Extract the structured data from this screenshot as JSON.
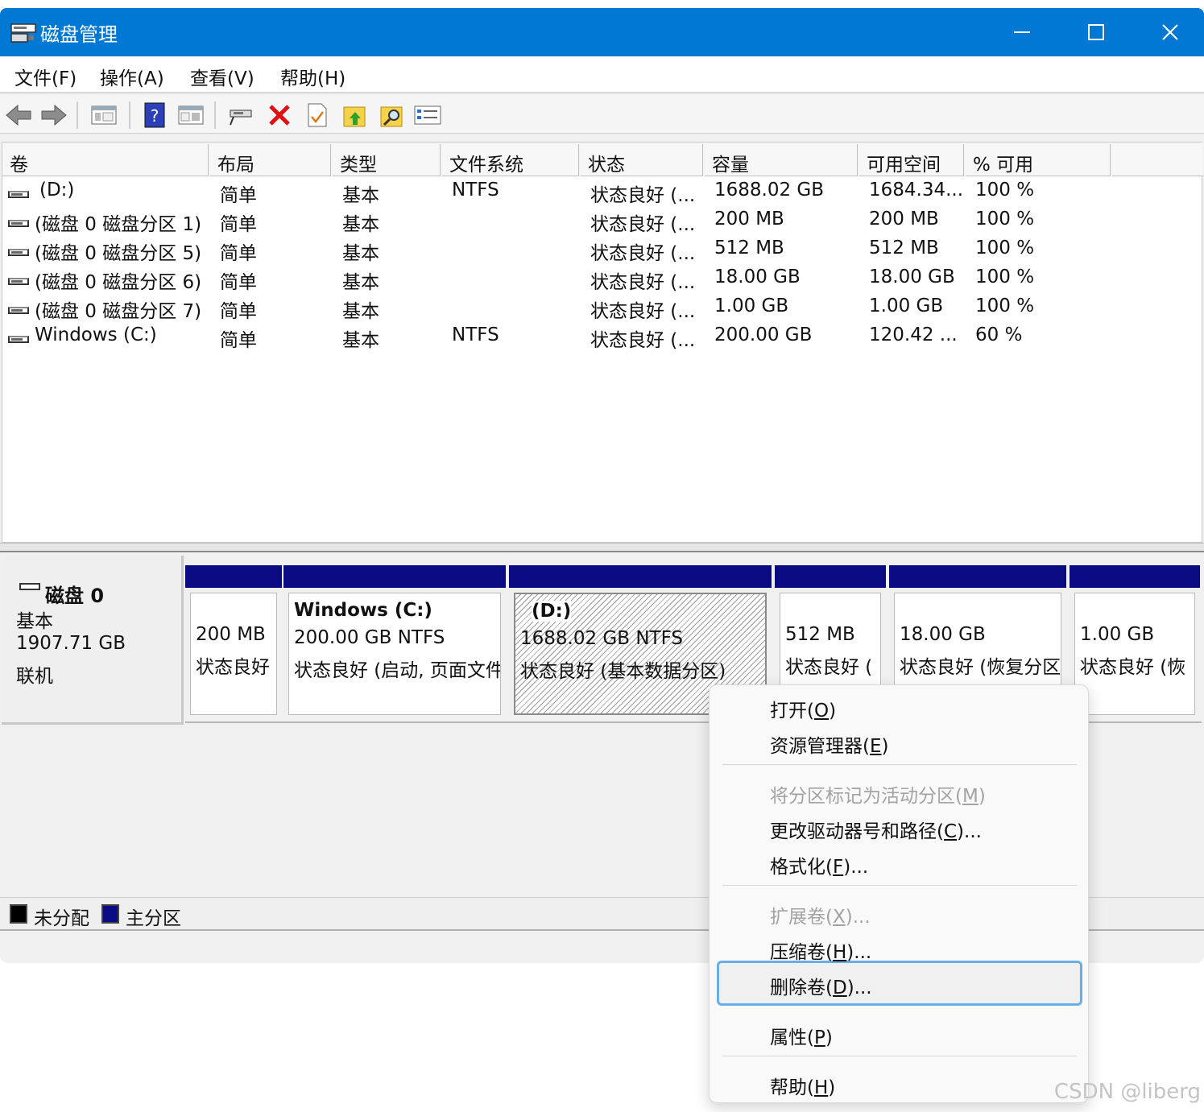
{
  "window": {
    "title": "磁盘管理"
  },
  "menu": [
    "文件(F)",
    "操作(A)",
    "查看(V)",
    "帮助(H)"
  ],
  "toolbar": {
    "icons": [
      "back-arrow-icon",
      "forward-arrow-icon",
      "console-tree-icon",
      "help-icon",
      "action-pane-icon",
      "connect-drive-icon",
      "delete-icon",
      "properties-icon",
      "up-folder-icon",
      "search-folder-icon",
      "details-list-icon"
    ]
  },
  "volume_table": {
    "headers": [
      "卷",
      "布局",
      "类型",
      "文件系统",
      "状态",
      "容量",
      "可用空间",
      "% 可用"
    ],
    "rows": [
      [
        "(D:)",
        "简单",
        "基本",
        "NTFS",
        "状态良好 (...",
        "1688.02 GB",
        "1684.34...",
        "100 %"
      ],
      [
        "(磁盘 0 磁盘分区 1)",
        "简单",
        "基本",
        "",
        "状态良好 (...",
        "200 MB",
        "200 MB",
        "100 %"
      ],
      [
        "(磁盘 0 磁盘分区 5)",
        "简单",
        "基本",
        "",
        "状态良好 (...",
        "512 MB",
        "512 MB",
        "100 %"
      ],
      [
        "(磁盘 0 磁盘分区 6)",
        "简单",
        "基本",
        "",
        "状态良好 (...",
        "18.00 GB",
        "18.00 GB",
        "100 %"
      ],
      [
        "(磁盘 0 磁盘分区 7)",
        "简单",
        "基本",
        "",
        "状态良好 (...",
        "1.00 GB",
        "1.00 GB",
        "100 %"
      ],
      [
        "Windows (C:)",
        "简单",
        "基本",
        "NTFS",
        "状态良好 (...",
        "200.00 GB",
        "120.42 ...",
        "60 %"
      ]
    ]
  },
  "disk": {
    "name": "磁盘 0",
    "type": "基本",
    "size": "1907.71 GB",
    "status": "联机"
  },
  "partitions": [
    {
      "title": "",
      "size": "200 MB",
      "status": "状态良好"
    },
    {
      "title": "Windows  (C:)",
      "size": "200.00 GB NTFS",
      "status": "状态良好 (启动, 页面文件"
    },
    {
      "title": "(D:)",
      "size": "1688.02 GB NTFS",
      "status": "状态良好 (基本数据分区)"
    },
    {
      "title": "",
      "size": "512 MB",
      "status": "状态良好 ("
    },
    {
      "title": "",
      "size": "18.00 GB",
      "status": "状态良好 (恢复分区"
    },
    {
      "title": "",
      "size": "1.00 GB",
      "status": "状态良好 (恢"
    }
  ],
  "legend": {
    "unallocated": "未分配",
    "primary": "主分区"
  },
  "context_menu": {
    "items": [
      {
        "pre": "打开(",
        "key": "O",
        "post": ")"
      },
      {
        "pre": "资源管理器(",
        "key": "E",
        "post": ")"
      },
      {
        "pre": "将分区标记为活动分区(",
        "key": "M",
        "post": ")"
      },
      {
        "pre": "更改驱动器号和路径(",
        "key": "C",
        "post": ")..."
      },
      {
        "pre": "格式化(",
        "key": "F",
        "post": ")..."
      },
      {
        "pre": "扩展卷(",
        "key": "X",
        "post": ")..."
      },
      {
        "pre": "压缩卷(",
        "key": "H",
        "post": ")..."
      },
      {
        "pre": "删除卷(",
        "key": "D",
        "post": ")..."
      },
      {
        "pre": "属性(",
        "key": "P",
        "post": ")"
      },
      {
        "pre": "帮助(",
        "key": "H",
        "post": ")"
      }
    ]
  },
  "watermark": "CSDN @liberg",
  "colors": {
    "titlebar": "#0078d4",
    "primary_partition": "#0a0a82",
    "unallocated": "#000000",
    "highlight_border": "#6aaee8"
  }
}
